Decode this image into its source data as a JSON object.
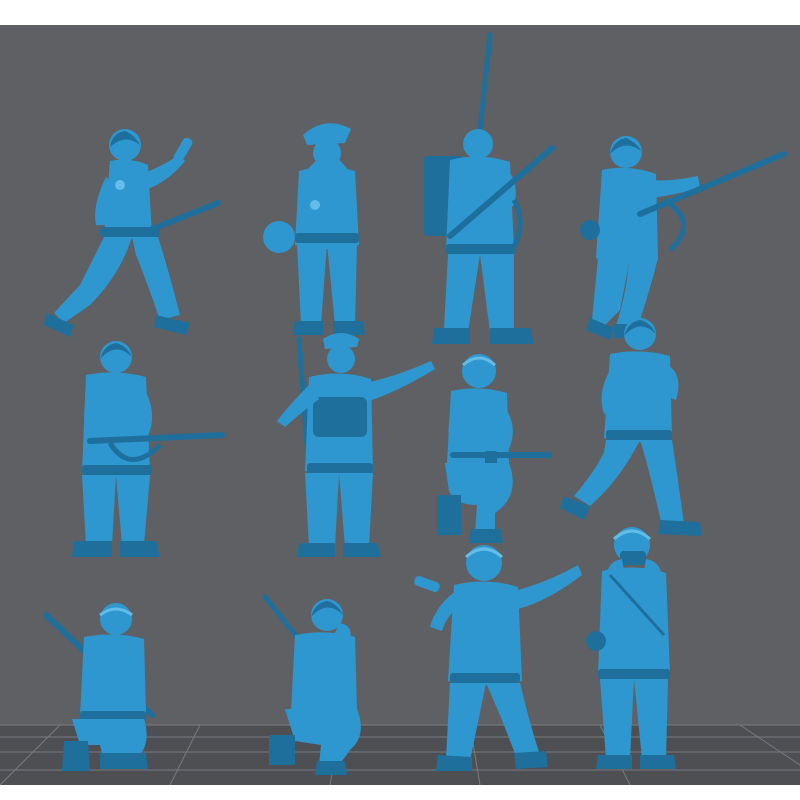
{
  "scene": {
    "background_color": "#5f6064",
    "floor_color": "#4e4f53",
    "grid_line_color": "#7a7b80",
    "model_color": "#2f97cf",
    "model_shadow_color": "#1e6f9c",
    "model_highlight_color": "#63bde8"
  },
  "figures": [
    {
      "id": "soldier-throwing-grenade",
      "pose": "throwing"
    },
    {
      "id": "officer-peaked-cap-binoculars",
      "pose": "binoculars"
    },
    {
      "id": "radioman-rifle-antenna",
      "pose": "radio"
    },
    {
      "id": "soldier-aiming-rifle-bayonet",
      "pose": "aiming"
    },
    {
      "id": "soldier-rifle-port-arms",
      "pose": "port-arms"
    },
    {
      "id": "soldier-cap-pointing",
      "pose": "pointing"
    },
    {
      "id": "kneeling-soldier-smg",
      "pose": "kneel-smg"
    },
    {
      "id": "soldier-crouching-advance",
      "pose": "advance"
    },
    {
      "id": "kneeling-soldier-rifle-shoulder",
      "pose": "kneel-rifle"
    },
    {
      "id": "kneeling-soldier-hand-to-face",
      "pose": "kneel-face"
    },
    {
      "id": "soldier-pointing-grenade",
      "pose": "pointing-grenade"
    },
    {
      "id": "soldier-with-binoculars",
      "pose": "standing-binoculars"
    }
  ]
}
